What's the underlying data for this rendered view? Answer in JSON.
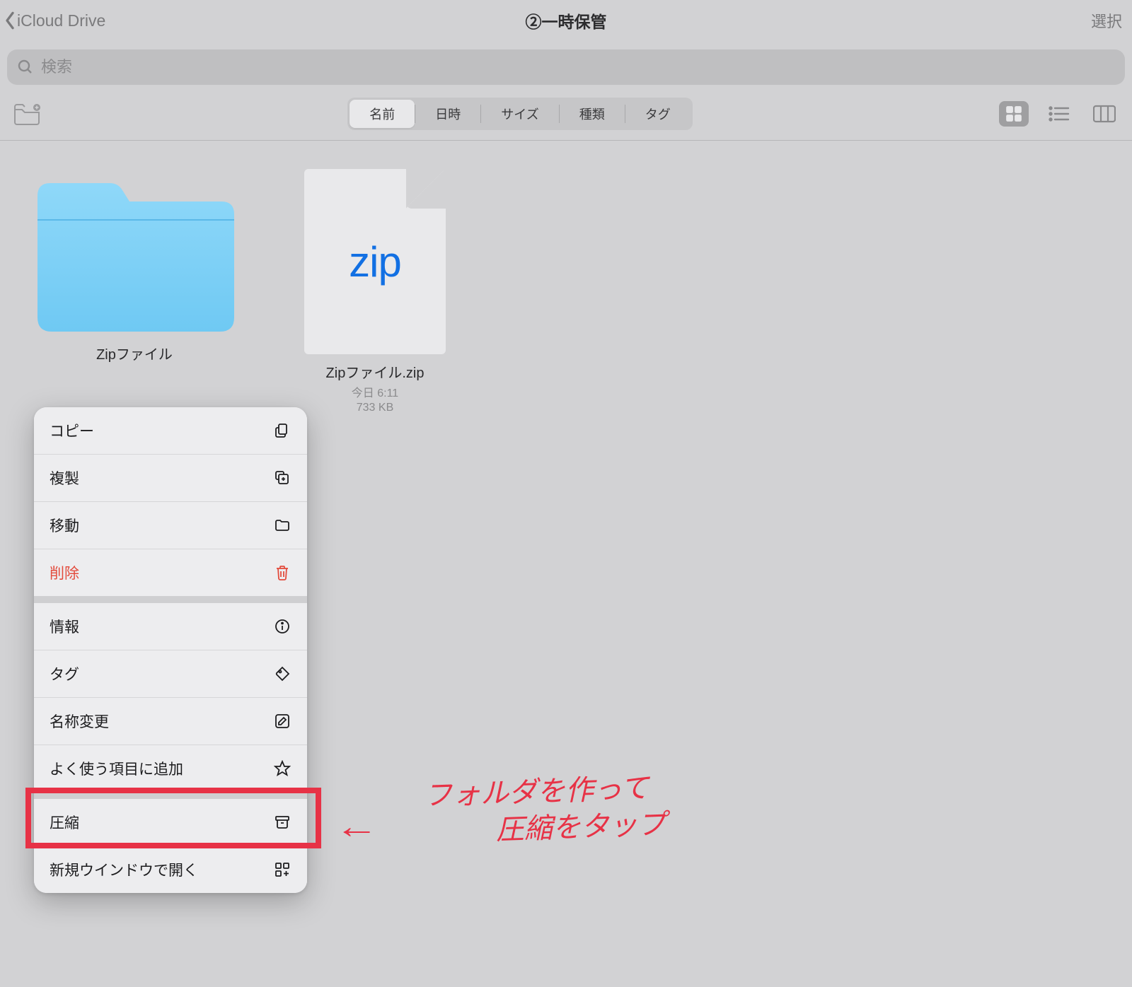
{
  "nav": {
    "back_label": "iCloud Drive",
    "title": "②一時保管",
    "select_label": "選択"
  },
  "search": {
    "placeholder": "検索"
  },
  "sort_segments": {
    "items": [
      "名前",
      "日時",
      "サイズ",
      "種類",
      "タグ"
    ],
    "active_index": 0
  },
  "files": {
    "folder": {
      "name": "Zipファイル"
    },
    "zip": {
      "name": "Zipファイル.zip",
      "date": "今日 6:11",
      "size": "733 KB",
      "badge": "zip"
    }
  },
  "context_menu": {
    "group1": [
      {
        "label": "コピー",
        "icon": "copy"
      },
      {
        "label": "複製",
        "icon": "duplicate"
      },
      {
        "label": "移動",
        "icon": "folder"
      },
      {
        "label": "削除",
        "icon": "trash",
        "danger": true
      }
    ],
    "group2": [
      {
        "label": "情報",
        "icon": "info"
      },
      {
        "label": "タグ",
        "icon": "tag"
      },
      {
        "label": "名称変更",
        "icon": "rename"
      },
      {
        "label": "よく使う項目に追加",
        "icon": "star"
      }
    ],
    "group3": [
      {
        "label": "圧縮",
        "icon": "archive"
      },
      {
        "label": "新規ウインドウで開く",
        "icon": "grid-plus"
      }
    ]
  },
  "annotation": {
    "line1": "フォルダを作って",
    "line2": "圧縮をタップ",
    "arrow": "←"
  }
}
